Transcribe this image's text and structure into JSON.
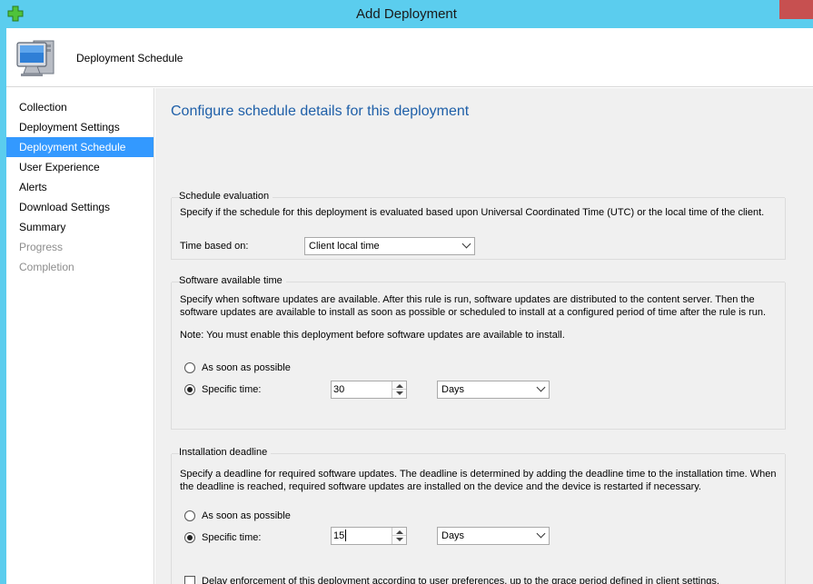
{
  "window": {
    "title": "Add Deployment"
  },
  "header": {
    "title": "Deployment Schedule"
  },
  "nav": {
    "items": [
      {
        "label": "Collection",
        "state": "normal"
      },
      {
        "label": "Deployment Settings",
        "state": "normal"
      },
      {
        "label": "Deployment Schedule",
        "state": "active"
      },
      {
        "label": "User Experience",
        "state": "normal"
      },
      {
        "label": "Alerts",
        "state": "normal"
      },
      {
        "label": "Download Settings",
        "state": "normal"
      },
      {
        "label": "Summary",
        "state": "normal"
      },
      {
        "label": "Progress",
        "state": "disabled"
      },
      {
        "label": "Completion",
        "state": "disabled"
      }
    ]
  },
  "page": {
    "title": "Configure schedule details for this deployment"
  },
  "schedule_evaluation": {
    "legend": "Schedule evaluation",
    "description": "Specify if the schedule for this deployment is evaluated based upon Universal Coordinated Time (UTC) or the local time of the client.",
    "time_based_label": "Time based on:",
    "time_based_value": "Client local time"
  },
  "available_time": {
    "legend": "Software available time",
    "description_1": "Specify when software updates are available. After this rule is run, software updates are distributed to the content server. Then the",
    "description_2": "software updates are available to install as soon as possible or scheduled to install at a configured period of time after the rule is run.",
    "note": "Note: You must enable this deployment before software updates are available to install.",
    "asap_label": "As soon as possible",
    "specific_label": "Specific time:",
    "value": "30",
    "unit": "Days",
    "selected": "specific"
  },
  "deadline": {
    "legend": "Installation deadline",
    "description_1": "Specify a deadline for required software updates. The deadline is determined by adding the deadline time to the installation time. When",
    "description_2": "the deadline is reached, required software updates are installed on the device and the device is restarted if necessary.",
    "asap_label": "As soon as possible",
    "specific_label": "Specific time:",
    "value": "15",
    "unit": "Days",
    "selected": "specific",
    "delay_label": "Delay enforcement of this deployment according to user preferences, up to the grace period defined in client settings.",
    "delay_checked": false
  },
  "colors": {
    "titlebar": "#5bcdee",
    "accent": "#3399ff",
    "heading": "#1e5fa8",
    "close": "#c75050"
  }
}
